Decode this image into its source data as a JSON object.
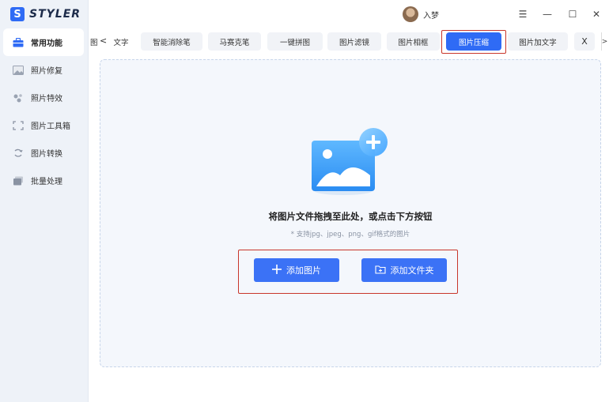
{
  "app": {
    "logo_letter": "S",
    "name": "STYLER"
  },
  "user": {
    "name": "入梦"
  },
  "window_controls": {
    "menu": "☰",
    "minimize": "—",
    "maximize": "☐",
    "close": "✕"
  },
  "sidebar": {
    "items": [
      {
        "label": "常用功能",
        "icon": "toolbox-icon",
        "active": true
      },
      {
        "label": "照片修复",
        "icon": "photo-repair-icon",
        "active": false
      },
      {
        "label": "照片特效",
        "icon": "sparkle-effects-icon",
        "active": false
      },
      {
        "label": "图片工具箱",
        "icon": "crop-frame-icon",
        "active": false
      },
      {
        "label": "图片转换",
        "icon": "convert-cycle-icon",
        "active": false
      },
      {
        "label": "批量处理",
        "icon": "batch-stack-icon",
        "active": false
      }
    ]
  },
  "tabs": {
    "partial_left": "图",
    "scroll_left": "<",
    "scroll_right": ">",
    "items": [
      {
        "label": "文字",
        "active": false
      },
      {
        "label": "智能消除笔",
        "active": false
      },
      {
        "label": "马赛克笔",
        "active": false
      },
      {
        "label": "一键拼图",
        "active": false
      },
      {
        "label": "图片滤镜",
        "active": false
      },
      {
        "label": "图片相框",
        "active": false
      },
      {
        "label": "图片压缩",
        "active": true
      },
      {
        "label": "图片加文字",
        "active": false
      },
      {
        "label": "X",
        "active": false
      }
    ]
  },
  "dropzone": {
    "illustration": "image-add-icon",
    "title": "将图片文件拖拽至此处，或点击下方按钮",
    "subtitle": "* 支持jpg、jpeg、png、gif格式的图片",
    "add_image_label": "添加图片",
    "add_folder_label": "添加文件夹"
  },
  "colors": {
    "accent": "#2f6bf5",
    "button": "#3b72f6",
    "highlight_frame": "#c8362b",
    "sidebar_bg": "#eef2f8"
  }
}
